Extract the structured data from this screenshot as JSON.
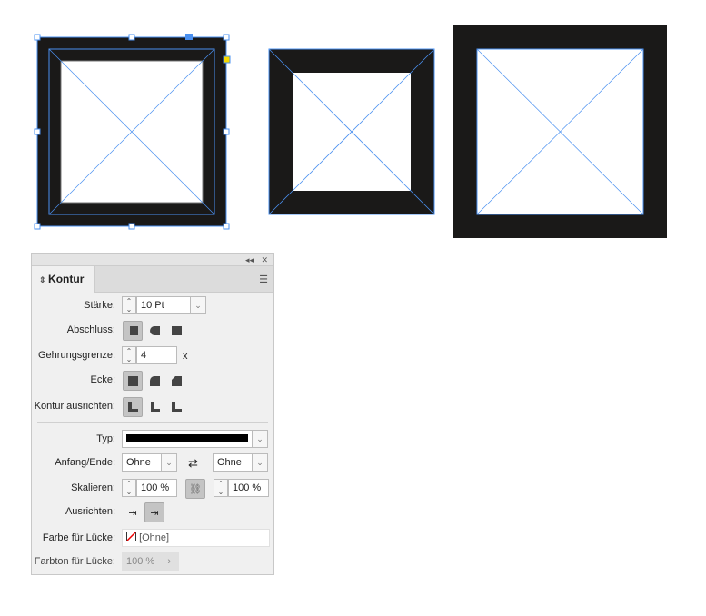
{
  "panel": {
    "title": "Kontur",
    "collapse_icon": "double-chevron-left",
    "close_icon": "x",
    "staerke": {
      "label": "Stärke:",
      "value": "10 Pt"
    },
    "abschluss": {
      "label": "Abschluss:"
    },
    "gehrung": {
      "label": "Gehrungsgrenze:",
      "value": "4",
      "suffix": "x"
    },
    "ecke": {
      "label": "Ecke:"
    },
    "ausrichten_kontur": {
      "label": "Kontur ausrichten:"
    },
    "typ": {
      "label": "Typ:"
    },
    "anfang": {
      "label": "Anfang/Ende:",
      "start": "Ohne",
      "end": "Ohne"
    },
    "skalieren": {
      "label": "Skalieren:",
      "start": "100 %",
      "end": "100 %"
    },
    "ausrichten": {
      "label": "Ausrichten:"
    },
    "farbe": {
      "label": "Farbe für Lücke:",
      "value": "[Ohne]"
    },
    "farbton": {
      "label": "Farbton für Lücke:",
      "value": "100 %"
    }
  },
  "colors": {
    "stroke": "#1a1918",
    "selection": "#4a90f0",
    "accent": "#f5d800"
  }
}
